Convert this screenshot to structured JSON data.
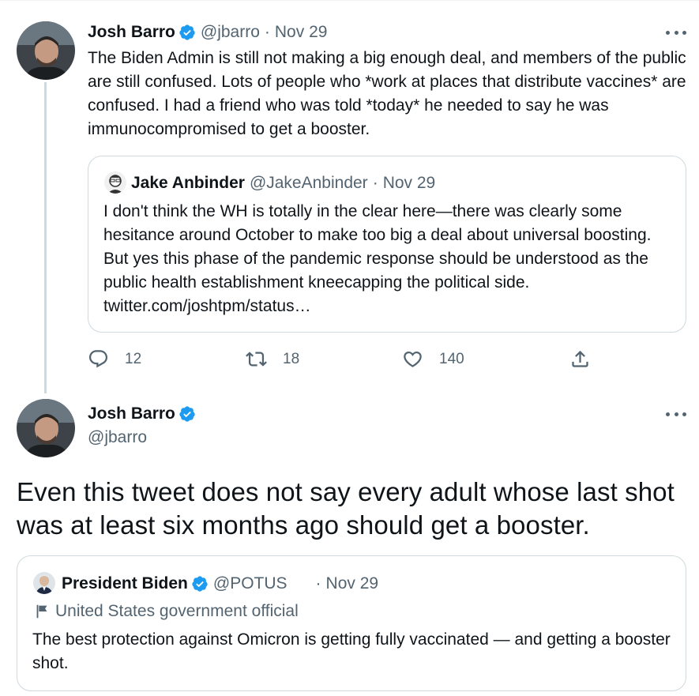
{
  "tweet1": {
    "name": "Josh Barro",
    "handle": "@jbarro",
    "separator": "·",
    "date": "Nov 29",
    "text": "The Biden Admin is still not making a big enough deal, and members of the public are still confused. Lots of people who *work at places that distribute vaccines* are confused. I had a friend who was told *today* he needed to say he was immunocompromised to get a booster.",
    "quote": {
      "name": "Jake Anbinder",
      "handle": "@JakeAnbinder",
      "separator": "·",
      "date": "Nov 29",
      "text": "I don't think the WH is totally in the clear here—there was clearly some hesitance around October to make too big a deal about universal boosting. But yes this phase of the pandemic response should be understood as the public health establishment kneecapping the political side. twitter.com/joshtpm/status…"
    },
    "actions": {
      "reply_count": "12",
      "retweet_count": "18",
      "like_count": "140"
    }
  },
  "tweet2": {
    "name": "Josh Barro",
    "handle": "@jbarro",
    "text": "Even this tweet does not say every adult whose last shot was at least six months ago should get a booster.",
    "quote": {
      "name": "President Biden",
      "handle": "@POTUS",
      "separator": "·",
      "date": "Nov 29",
      "label": "United States government official",
      "text": "The best protection against Omicron is getting fully vaccinated — and getting a booster shot."
    }
  },
  "colors": {
    "verified": "#1d9bf0",
    "secondary_text": "#536471",
    "border": "#cfd9de"
  },
  "icons": {
    "more": "more-dots-icon",
    "reply": "reply-icon",
    "retweet": "retweet-icon",
    "like": "heart-icon",
    "share": "share-icon",
    "verified": "verified-badge-icon",
    "flag": "flag-icon"
  }
}
